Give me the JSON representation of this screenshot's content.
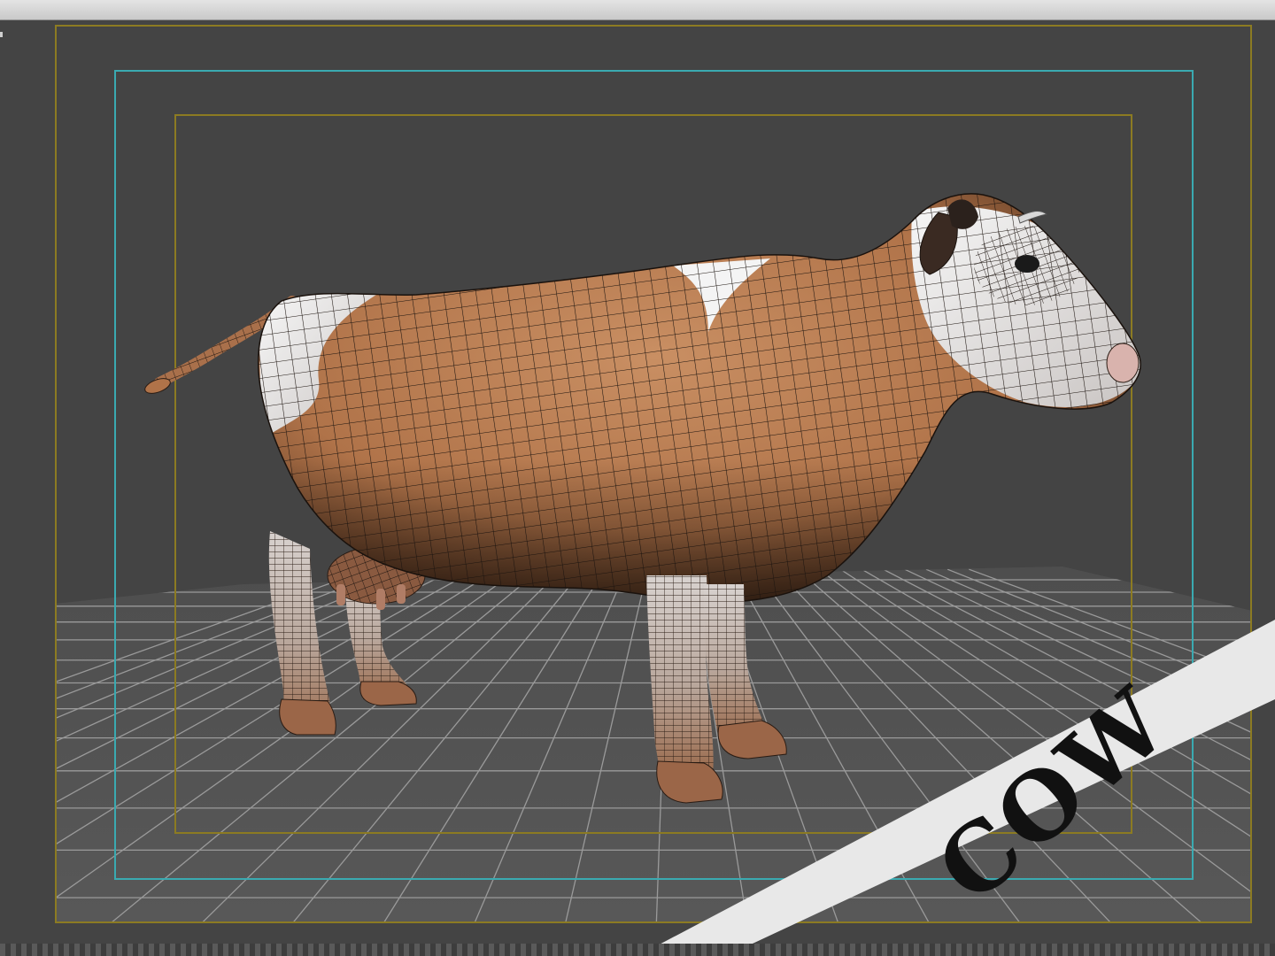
{
  "viewport": {
    "background_color": "#444444",
    "grid_line_color": "#9a9a9a",
    "safe_frame_outer_color": "#8c7b22",
    "safe_frame_action_color": "#3aaab1",
    "safe_frame_title_color": "#8c7b22",
    "shading": "textured-with-wireframe",
    "model": "cow-lowpoly-mesh",
    "model_colors": {
      "hide": "#b7784f",
      "patch": "#eeeeee",
      "wire": "#1c140f"
    }
  },
  "banner": {
    "label": "COW",
    "background_color": "#e8e8e8",
    "text_color": "#111111"
  }
}
